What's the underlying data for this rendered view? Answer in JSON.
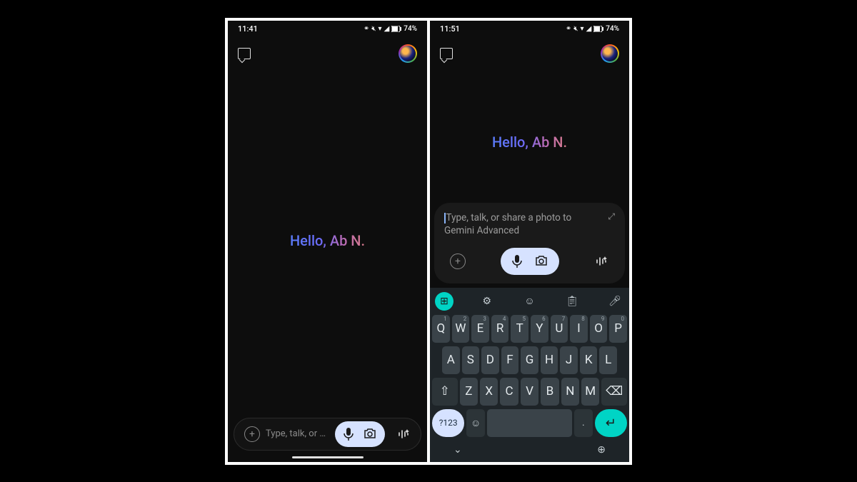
{
  "left": {
    "status": {
      "time": "11:41",
      "battery": "74%"
    },
    "greeting": "Hello, Ab N.",
    "input": {
      "placeholder": "Type, talk, or share…"
    }
  },
  "right": {
    "status": {
      "time": "11:51",
      "battery": "74%"
    },
    "greeting": "Hello, Ab N.",
    "input": {
      "placeholder": "Type, talk, or share a photo to Gemini Advanced"
    },
    "keyboard": {
      "row1": [
        "Q",
        "W",
        "E",
        "R",
        "T",
        "Y",
        "U",
        "I",
        "O",
        "P"
      ],
      "row1hints": [
        "1",
        "2",
        "3",
        "4",
        "5",
        "6",
        "7",
        "8",
        "9",
        "0"
      ],
      "row2": [
        "A",
        "S",
        "D",
        "F",
        "G",
        "H",
        "J",
        "K",
        "L"
      ],
      "row3": [
        "Z",
        "X",
        "C",
        "V",
        "B",
        "N",
        "M"
      ],
      "symKey": "?123",
      "period": "."
    }
  }
}
